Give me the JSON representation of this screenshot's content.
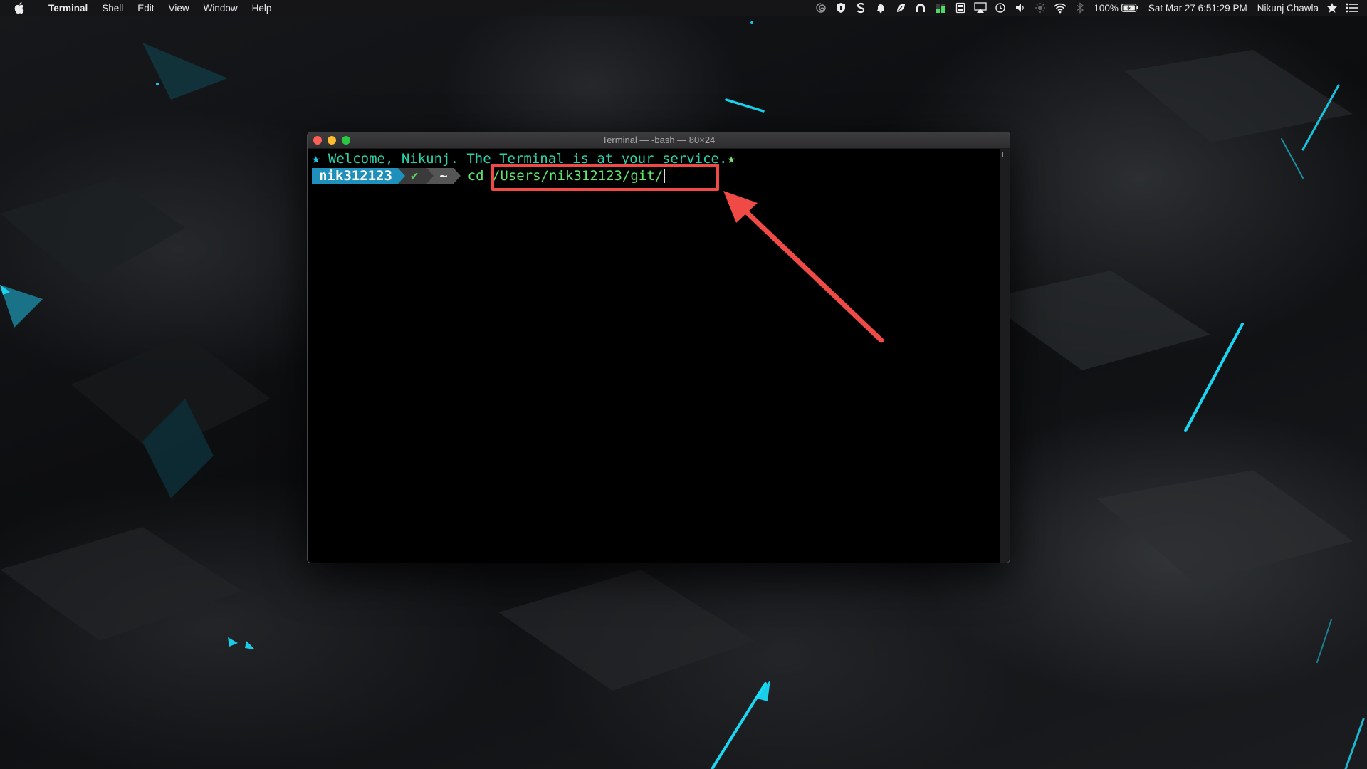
{
  "menubar": {
    "app_name": "Terminal",
    "items": [
      "Shell",
      "Edit",
      "View",
      "Window",
      "Help"
    ],
    "battery": "100%",
    "datetime": "Sat Mar 27  6:51:29 PM",
    "user": "Nikunj Chawla",
    "status_icons": [
      "spiral-icon",
      "shield-icon",
      "s-icon",
      "bell-icon",
      "leaf-icon",
      "arch-icon",
      "bars-icon",
      "memory-icon",
      "airplay-icon",
      "time-machine-icon",
      "volume-icon",
      "brightness-icon",
      "wifi-icon",
      "bluetooth-icon",
      "battery-icon",
      "star-icon",
      "list-icon"
    ]
  },
  "terminal": {
    "title": "Terminal — -bash — 80×24",
    "welcome_star": "★",
    "welcome_text": " Welcome, Nikunj. The Terminal is at your service.",
    "welcome_star_end": "★",
    "prompt_user": "nik312123",
    "prompt_status": "✔",
    "prompt_dir": "~",
    "command": "cd /Users/nik312123/git/"
  },
  "colors": {
    "annotation": "#ef4a45",
    "prompt_user_bg": "#1f8fbb",
    "command_text": "#5fe86a",
    "welcome_text": "#2cd1a8"
  }
}
